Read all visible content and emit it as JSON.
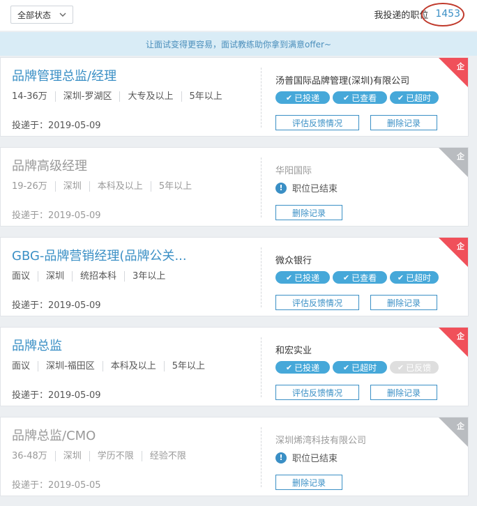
{
  "filter": {
    "label": "全部状态"
  },
  "header": {
    "label": "我投递的职位",
    "count": "1453"
  },
  "banner": {
    "text": "让面试变得更容易，面试教练助你拿到满意offer~"
  },
  "cards": [
    {
      "title": "品牌管理总监/经理",
      "tags": [
        "14-36万",
        "深圳-罗湖区",
        "大专及以上",
        "5年以上"
      ],
      "date": "投递于：2019-05-09",
      "company": "汤普国际品牌管理(深圳)有限公司",
      "steps": [
        "已投递",
        "已查看",
        "已超时"
      ],
      "eval_label": "评估反馈情况",
      "delete_label": "删除记录",
      "corner": "企"
    },
    {
      "title": "品牌高级经理",
      "tags": [
        "19-26万",
        "深圳",
        "本科及以上",
        "5年以上"
      ],
      "date": "投递于：2019-05-09",
      "company": "华阳国际",
      "ended_text": "职位已结束",
      "delete_label": "删除记录",
      "corner": "企"
    },
    {
      "title": "GBG-品牌营销经理(品牌公关...",
      "tags": [
        "面议",
        "深圳",
        "统招本科",
        "3年以上"
      ],
      "date": "投递于：2019-05-09",
      "company": "微众银行",
      "steps": [
        "已投递",
        "已查看",
        "已超时"
      ],
      "eval_label": "评估反馈情况",
      "delete_label": "删除记录",
      "corner": "企"
    },
    {
      "title": "品牌总监",
      "tags": [
        "面议",
        "深圳-福田区",
        "本科及以上",
        "5年以上"
      ],
      "date": "投递于：2019-05-09",
      "company": "和宏实业",
      "steps": [
        "已投递",
        "已超时",
        "已反馈"
      ],
      "eval_label": "评估反馈情况",
      "delete_label": "删除记录",
      "corner": "企"
    },
    {
      "title": "品牌总监/CMO",
      "tags": [
        "36-48万",
        "深圳",
        "学历不限",
        "经验不限"
      ],
      "date": "投递于：2019-05-05",
      "company": "深圳烯湾科技有限公司",
      "ended_text": "职位已结束",
      "delete_label": "删除记录",
      "corner": "企"
    }
  ],
  "colors": {
    "accent": "#3a8fc5",
    "step": "#46a8d9",
    "corner_active": "#f0505a",
    "corner_inactive": "#b9bcc0",
    "highlight_circle": "#c0392b"
  }
}
